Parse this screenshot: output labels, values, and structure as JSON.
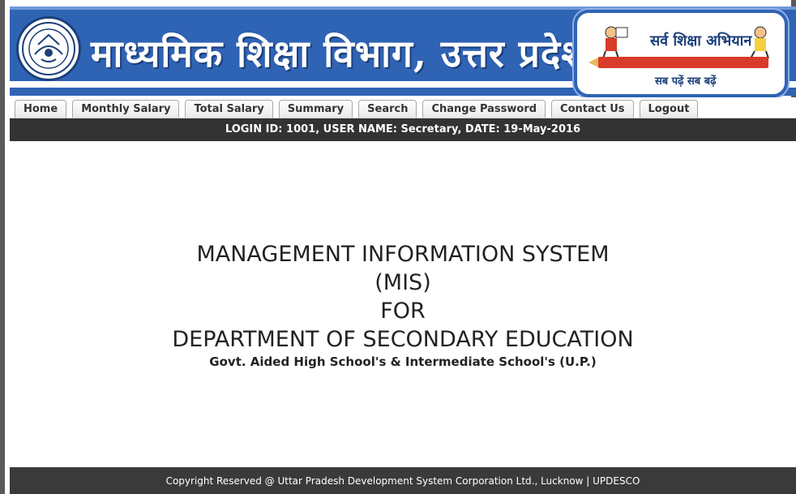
{
  "header": {
    "title": "माध्यमिक शिक्षा विभाग, उत्तर प्रदेश",
    "ssa": {
      "slogan": "सर्व शिक्षा अभियान",
      "tagline": "सब पढ़ें सब बढ़ें"
    }
  },
  "nav": {
    "tabs": [
      "Home",
      "Monthly Salary",
      "Total Salary",
      "Summary",
      "Search",
      "Change Password",
      "Contact Us",
      "Logout"
    ]
  },
  "login_bar": {
    "text": "LOGIN ID: 1001, USER NAME: Secretary, DATE: 19-May-2016"
  },
  "main": {
    "line1": "MANAGEMENT INFORMATION SYSTEM",
    "line2": "(MIS)",
    "line3": "FOR",
    "line4": "DEPARTMENT OF SECONDARY EDUCATION",
    "line5": "Govt. Aided High School's & Intermediate School's (U.P.)"
  },
  "footer": {
    "text": "Copyright Reserved @ Uttar Pradesh Development System Corporation Ltd., Lucknow | UPDESCO"
  },
  "colors": {
    "header_blue": "#2f63b4",
    "bar_dark": "#333333",
    "footer_dark": "#3a3a3a"
  }
}
